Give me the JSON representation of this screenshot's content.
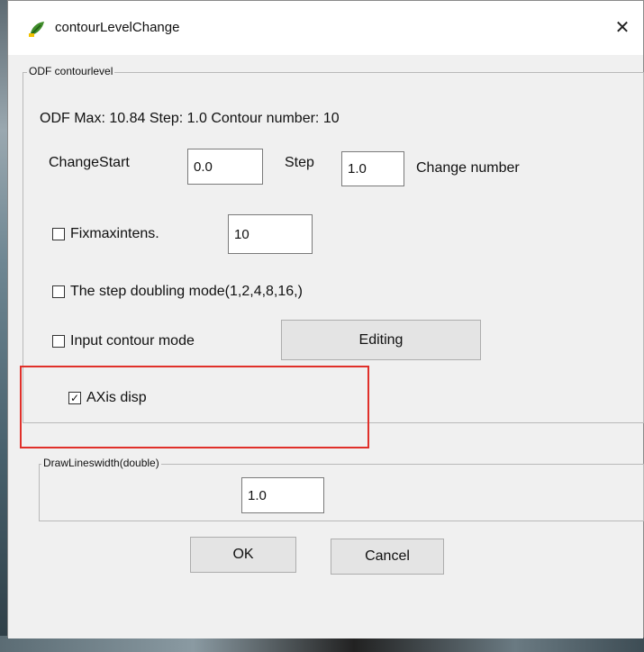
{
  "window": {
    "title": "contourLevelChange",
    "close_glyph": "✕",
    "icon": "app-leaf-icon"
  },
  "odf_group": {
    "legend": "ODF contourlevel",
    "info_text": "ODF Max: 10.84 Step: 1.0 Contour number: 10",
    "change_start_label": "ChangeStart",
    "change_start_value": "0.0",
    "step_label": "Step",
    "step_value": "1.0",
    "change_number_label": "Change number",
    "fix_max": {
      "label": "Fixmaxintens.",
      "checked": false,
      "value": "10"
    },
    "step_doubling": {
      "label": "The step doubling mode(1,2,4,8,16,)",
      "checked": false
    },
    "input_contour": {
      "label": "Input contour mode",
      "checked": false
    },
    "editing_button": "Editing",
    "axis_disp": {
      "label": "AXis disp",
      "checked": true
    }
  },
  "line_width_group": {
    "legend": "DrawLineswidth(double)",
    "value": "1.0"
  },
  "buttons": {
    "ok": "OK",
    "cancel": "Cancel"
  },
  "colors": {
    "highlight": "#e0302a",
    "window_bg": "#f0f0f0"
  },
  "glyphs": {
    "checked": "✓",
    "unchecked": ""
  }
}
